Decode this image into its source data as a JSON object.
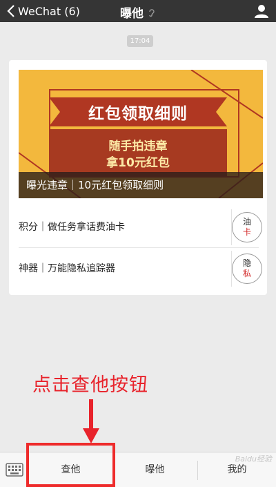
{
  "navbar": {
    "back_label": "WeChat (6)",
    "title": "曝他"
  },
  "timestamp": "17:04",
  "card": {
    "banner": {
      "ribbon_title": "红包领取细则",
      "line1": "随手拍违章",
      "line2": "拿10元红包",
      "caption": "曝光违章｜10元红包领取细则"
    },
    "items": [
      {
        "label": "积分｜做任务拿话费油卡",
        "thumb_top": "油",
        "thumb_bottom": "卡"
      },
      {
        "label": "神器｜万能隐私追踪器",
        "thumb_top": "隐",
        "thumb_bottom": "私"
      }
    ]
  },
  "annotation": "点击查他按钮",
  "tabbar": {
    "tabs": [
      "查他",
      "曝他",
      "我的"
    ]
  },
  "watermark": "Baidu经验",
  "colors": {
    "navbar": "#353535",
    "banner_yellow": "#f3b83d",
    "banner_red": "#a73a21",
    "annotation_red": "#e8232b"
  }
}
